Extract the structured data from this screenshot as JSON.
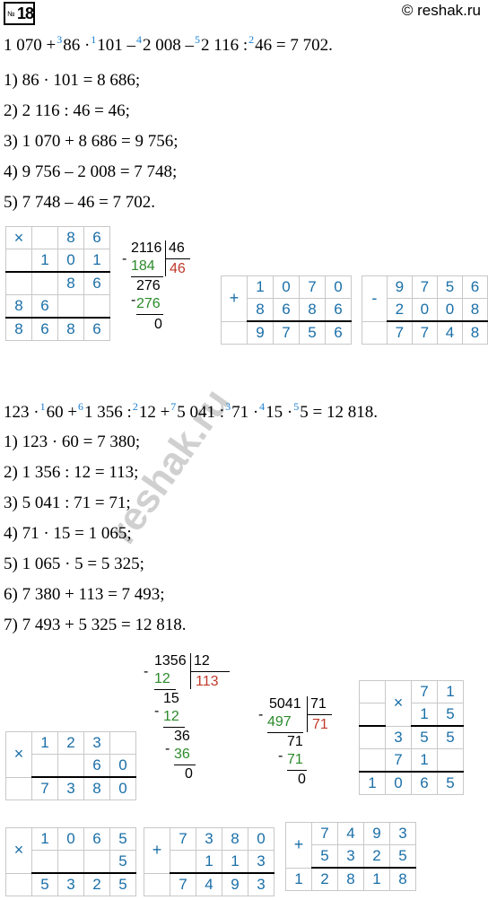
{
  "badge": {
    "no": "№",
    "num": "18"
  },
  "watermark_top": "© reshak.ru",
  "watermark_diag": "reshak.ru",
  "part1": {
    "expr": {
      "t0": "1 070 +",
      "s1": "3",
      "t1": "86 ·",
      "s2": "1",
      "t2": "101 –",
      "s3": "4",
      "t3": "2 008 –",
      "s4": "5",
      "t4": "2 116 :",
      "s5": "2",
      "t5": "46 = 7 702."
    },
    "steps": [
      "1) 86 · 101 = 8 686;",
      "2) 2 116 : 46 = 46;",
      "3) 1 070 + 8 686 = 9 756;",
      "4) 9 756 – 2 008 = 7 748;",
      "5) 7 748 – 46 = 7 702."
    ],
    "mult": {
      "op": "×",
      "r1": [
        "",
        "",
        "8",
        "6"
      ],
      "r2": [
        "",
        "1",
        "0",
        "1"
      ],
      "r3": [
        "",
        "",
        "8",
        "6"
      ],
      "r4": [
        "8",
        "6",
        "",
        ""
      ],
      "res": [
        "8",
        "6",
        "8",
        "6"
      ]
    },
    "div": {
      "dividend": "2116",
      "divisor": "46",
      "sub1": "184",
      "rem1": "276",
      "sub2": "276",
      "rem2": "0",
      "quot": "46",
      "minus": "-"
    },
    "add": {
      "op": "+",
      "r1": [
        "1",
        "0",
        "7",
        "0"
      ],
      "r2": [
        "8",
        "6",
        "8",
        "6"
      ],
      "res": [
        "9",
        "7",
        "5",
        "6"
      ]
    },
    "sub": {
      "op": "-",
      "r1": [
        "9",
        "7",
        "5",
        "6"
      ],
      "r2": [
        "2",
        "0",
        "0",
        "8"
      ],
      "res": [
        "7",
        "7",
        "4",
        "8"
      ]
    }
  },
  "part2": {
    "expr": {
      "t0": "123 ·",
      "s1": "1",
      "t1": "60 +",
      "s2": "6",
      "t2": "1 356 :",
      "s3": "2",
      "t3": "12 +",
      "s4": "7",
      "t4": "5 041 :",
      "s5": "3",
      "t5": "71 ·",
      "s6": "4",
      "t6": "15 ·",
      "s7": "5",
      "t7": "5 = 12 818."
    },
    "steps": [
      "1) 123 · 60 = 7 380;",
      "2) 1 356 : 12 = 113;",
      "3) 5 041 : 71 = 71;",
      "4) 71 · 15 = 1 065;",
      "5) 1 065 · 5 = 5 325;",
      "6) 7 380 + 113 = 7 493;",
      "7) 7 493 + 5 325 = 12 818."
    ],
    "mult1": {
      "op": "×",
      "r1": [
        "1",
        "2",
        "3",
        ""
      ],
      "r2": [
        "",
        "",
        "6",
        "0"
      ],
      "res": [
        "7",
        "3",
        "8",
        "0"
      ]
    },
    "div1": {
      "dividend": "1356",
      "divisor": "12",
      "sub1": "12",
      "rem1": "15",
      "sub2": "12",
      "rem2": "36",
      "sub3": "36",
      "rem3": "0",
      "quot": "113"
    },
    "div2": {
      "dividend": "5041",
      "divisor": "71",
      "sub1": "497",
      "rem1": "71",
      "sub2": "71",
      "rem2": "0",
      "quot": "71"
    },
    "mult2": {
      "op": "×",
      "r1": [
        "",
        "",
        "7",
        "1"
      ],
      "r2": [
        "",
        "",
        "1",
        "5"
      ],
      "r3": [
        "",
        "3",
        "5",
        "5"
      ],
      "r4": [
        "",
        "7",
        "1",
        ""
      ],
      "res": [
        "1",
        "0",
        "6",
        "5"
      ]
    },
    "mult3": {
      "op": "×",
      "r1": [
        "1",
        "0",
        "6",
        "5"
      ],
      "r2": [
        "",
        "",
        "",
        "5"
      ],
      "res": [
        "5",
        "3",
        "2",
        "5"
      ]
    },
    "add1": {
      "op": "+",
      "r1": [
        "7",
        "3",
        "8",
        "0"
      ],
      "r2": [
        "",
        "1",
        "1",
        "3"
      ],
      "res": [
        "7",
        "4",
        "9",
        "3"
      ]
    },
    "add2": {
      "op": "+",
      "r1": [
        "",
        "7",
        "4",
        "9",
        "3"
      ],
      "r2": [
        "",
        "5",
        "3",
        "2",
        "5"
      ],
      "res": [
        "1",
        "2",
        "8",
        "1",
        "8"
      ]
    }
  }
}
